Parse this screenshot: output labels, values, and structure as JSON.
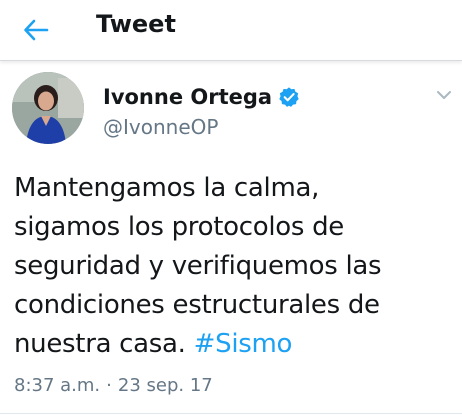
{
  "header": {
    "title": "Tweet",
    "back_icon": "arrow-left-icon"
  },
  "tweet": {
    "author": {
      "display_name": "Ivonne Ortega",
      "handle": "@IvonneOP",
      "verified": true,
      "verified_icon": "verified-badge-icon"
    },
    "menu_icon": "chevron-down-icon",
    "text_lines": [
      "Mantengamos la calma,",
      "sigamos los protocolos de",
      "seguridad y verifiquemos las",
      "condiciones estructurales de",
      "nuestra casa."
    ],
    "hashtag": "#Sismo",
    "time": "8:37 a.m.",
    "separator": "·",
    "date": "23 sep. 17"
  },
  "colors": {
    "accent": "#1da1f2",
    "text": "#14171a",
    "secondary": "#657786"
  }
}
